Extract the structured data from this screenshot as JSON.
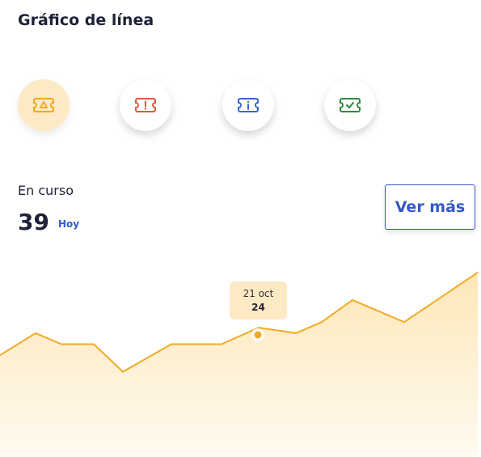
{
  "title": "Gráfico de línea",
  "icons": [
    {
      "name": "ticket-triangle-icon",
      "color": "#f0a81d",
      "active": true
    },
    {
      "name": "ticket-alert-icon",
      "color": "#e05a3a",
      "active": false
    },
    {
      "name": "ticket-info-icon",
      "color": "#3a64d8",
      "active": false
    },
    {
      "name": "ticket-check-icon",
      "color": "#2e8a3a",
      "active": false
    }
  ],
  "status": {
    "label": "En curso",
    "count": "39",
    "period": "Hoy"
  },
  "more_button_label": "Ver más",
  "colors": {
    "line": "#f2aa22",
    "area_top": "#fde7b8",
    "area_bottom": "#fffaf0",
    "accent_blue": "#3558c9"
  },
  "chart_data": {
    "type": "area",
    "values": [
      18,
      22,
      20,
      20,
      15,
      20,
      20,
      23,
      22,
      24,
      28,
      24,
      33
    ],
    "ylim": [
      0,
      34
    ],
    "tooltip": {
      "date": "21 oct",
      "value": "24"
    }
  }
}
